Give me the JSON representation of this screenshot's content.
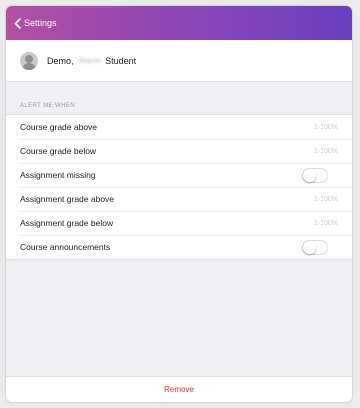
{
  "nav": {
    "back_label": "Settings"
  },
  "student": {
    "prefix": "Demo,",
    "hidden_name": "Jeanie",
    "suffix": "Student"
  },
  "section": {
    "header": "ALERT ME WHEN"
  },
  "rows": [
    {
      "label": "Course grade above",
      "value": "1-100%",
      "type": "value"
    },
    {
      "label": "Course grade below",
      "value": "1-100%",
      "type": "value"
    },
    {
      "label": "Assignment missing",
      "type": "toggle",
      "on": false
    },
    {
      "label": "Assignment grade above",
      "value": "1-100%",
      "type": "value"
    },
    {
      "label": "Assignment grade below",
      "value": "1-100%",
      "type": "value"
    },
    {
      "label": "Course announcements",
      "type": "toggle",
      "on": false
    }
  ],
  "footer": {
    "remove_label": "Remove"
  },
  "colors": {
    "accent_start": "#b34fa2",
    "accent_end": "#6a3fc0",
    "destructive": "#e0312f"
  },
  "icons": {
    "back": "chevron-left-icon",
    "avatar": "person-icon"
  }
}
